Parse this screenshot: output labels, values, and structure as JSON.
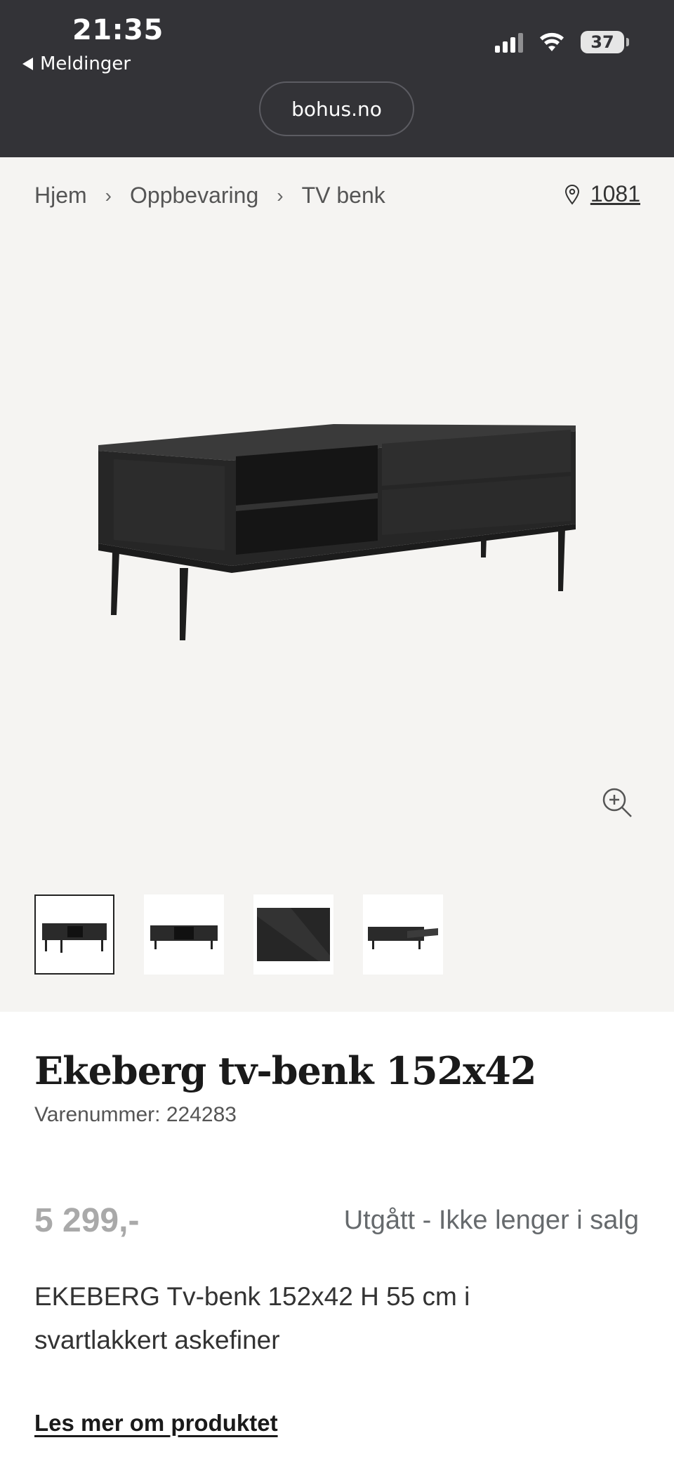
{
  "status_bar": {
    "time": "21:35",
    "back_label": "Meldinger",
    "battery": "37",
    "url": "bohus.no"
  },
  "breadcrumb": {
    "items": [
      "Hjem",
      "Oppbevaring",
      "TV benk"
    ]
  },
  "store": {
    "number": "1081"
  },
  "product": {
    "title": "Ekeberg tv-benk 152x42",
    "sku_label": "Varenummer: 224283",
    "price": "5 299,-",
    "availability": "Utgått - Ikke lenger i salg",
    "description": "EKEBERG Tv-benk 152x42 H 55 cm i svartlakkert askefiner",
    "read_more": "Les mer om produktet"
  },
  "colors": {
    "header_bg": "#333337",
    "gallery_bg": "#f5f4f2",
    "furniture": "#2a2a2a"
  }
}
